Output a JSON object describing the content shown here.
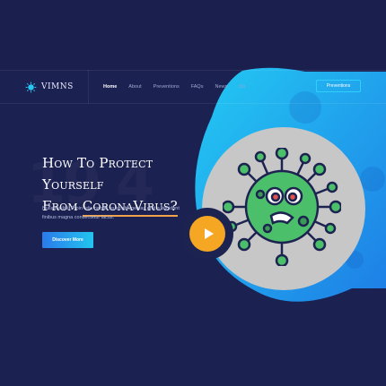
{
  "brand": {
    "name": "VIMNS"
  },
  "nav": {
    "items": [
      {
        "label": "Home"
      },
      {
        "label": "About"
      },
      {
        "label": "Preventions"
      },
      {
        "label": "FAQs"
      },
      {
        "label": "News"
      },
      {
        "label": "Co"
      }
    ],
    "cta_label": "Preventions"
  },
  "hero": {
    "heading_line1": "How To Protect Yourself",
    "heading_line2_prefix": "From",
    "heading_highlight": "CoronaVirus?",
    "ghost_number": "19",
    "ghost_number2": "4",
    "description": "Nulla facilisi. Proin felis neque, suscipit egestas erat a tincidunt finibus magna consectetur lacus.",
    "button_label": "Discover More"
  },
  "colors": {
    "background": "#1b2150",
    "accent": "#2fd0ff",
    "highlight": "#f1a24a",
    "play": "#f5a623",
    "virus": "#4cbf6a"
  },
  "icons": {
    "logo": "virus-logo-icon",
    "play": "play-icon",
    "illustration": "coronavirus-illustration"
  }
}
